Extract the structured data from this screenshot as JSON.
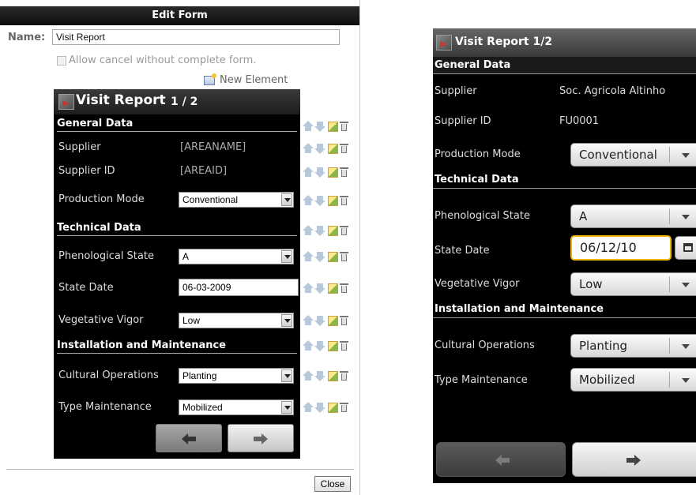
{
  "dialog": {
    "title": "Edit Form",
    "name_label": "Name:",
    "name_value": "Visit Report",
    "allow_cancel_label": "Allow cancel without complete form.",
    "allow_cancel_checked": false,
    "new_element_label": "New Element",
    "close_label": "Close"
  },
  "editor_preview": {
    "title": "Visit Report",
    "page": "1 / 2",
    "rows": [
      {
        "kind": "section",
        "label": "General Data"
      },
      {
        "kind": "text",
        "label": "Supplier",
        "value": "[AREANAME]"
      },
      {
        "kind": "text",
        "label": "Supplier ID",
        "value": "[AREAID]"
      },
      {
        "kind": "select",
        "label": "Production Mode",
        "value": "Conventional"
      },
      {
        "kind": "section",
        "label": "Technical Data"
      },
      {
        "kind": "select",
        "label": "Phenological State",
        "value": "A"
      },
      {
        "kind": "input",
        "label": "State Date",
        "value": "06-03-2009"
      },
      {
        "kind": "select",
        "label": "Vegetative Vigor",
        "value": "Low"
      },
      {
        "kind": "section",
        "label": "Installation and Maintenance"
      },
      {
        "kind": "select",
        "label": "Cultural Operations",
        "value": "Planting"
      },
      {
        "kind": "select",
        "label": "Type Maintenance",
        "value": "Mobilized"
      }
    ]
  },
  "device_preview": {
    "title": "Visit Report 1/2",
    "rows": [
      {
        "kind": "section",
        "label": "General Data"
      },
      {
        "kind": "text",
        "label": "Supplier",
        "value": "Soc. Agricola Altinho"
      },
      {
        "kind": "text",
        "label": "Supplier ID",
        "value": "FU0001"
      },
      {
        "kind": "select",
        "label": "Production Mode",
        "value": "Conventional"
      },
      {
        "kind": "section",
        "label": "Technical Data"
      },
      {
        "kind": "select",
        "label": "Phenological State",
        "value": "A"
      },
      {
        "kind": "input",
        "label": "State Date",
        "value": "06/12/10"
      },
      {
        "kind": "select",
        "label": "Vegetative Vigor",
        "value": "Low"
      },
      {
        "kind": "section",
        "label": "Installation and Maintenance"
      },
      {
        "kind": "select",
        "label": "Cultural Operations",
        "value": "Planting"
      },
      {
        "kind": "select",
        "label": "Type Maintenance",
        "value": "Mobilized"
      }
    ]
  },
  "colors": {
    "date_focus_border": "#f2b705",
    "phone_background": "#000000"
  }
}
